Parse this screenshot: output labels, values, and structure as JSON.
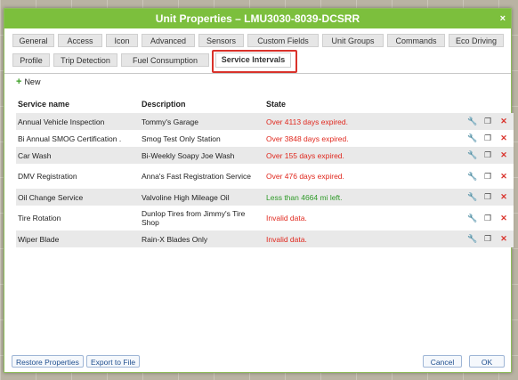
{
  "window": {
    "title": "Unit Properties – LMU3030-8039-DCSRR",
    "close_label": "×"
  },
  "tabs_row1": [
    "General",
    "Access",
    "Icon",
    "Advanced",
    "Sensors",
    "Custom Fields",
    "Unit Groups",
    "Commands",
    "Eco Driving"
  ],
  "tabs_row2": [
    "Profile",
    "Trip Detection",
    "Fuel Consumption",
    "Service Intervals"
  ],
  "active_tab": "Service Intervals",
  "toolbar": {
    "new_label": "New"
  },
  "table": {
    "headers": [
      "Service name",
      "Description",
      "State"
    ],
    "rows": [
      {
        "name": "Annual Vehicle Inspection",
        "description": "Tommy's Garage",
        "state": "Over 4113 days expired.",
        "state_color": "#e0281e"
      },
      {
        "name": "Bi Annual SMOG Certification .",
        "description": "Smog Test Only Station",
        "state": "Over 3848 days expired.",
        "state_color": "#e0281e"
      },
      {
        "name": "Car Wash",
        "description": "Bi-Weekly Soapy Joe Wash",
        "state": "Over 155 days expired.",
        "state_color": "#e0281e"
      },
      {
        "name": "DMV Registration",
        "description": "Anna's Fast Registration Service",
        "state": "Over 476 days expired.",
        "state_color": "#e0281e"
      },
      {
        "name": "Oil Change Service",
        "description": "Valvoline High Mileage Oil",
        "state": "Less than 4664 mi left.",
        "state_color": "#2e9a28"
      },
      {
        "name": "Tire Rotation",
        "description": "Dunlop Tires from Jimmy's Tire Shop",
        "state": "Invalid data.",
        "state_color": "#e0281e"
      },
      {
        "name": "Wiper Blade",
        "description": "Rain-X Blades Only",
        "state": "Invalid data.",
        "state_color": "#e0281e"
      }
    ]
  },
  "footer": {
    "restore_label": "Restore Properties",
    "export_label": "Export to File",
    "cancel_label": "Cancel",
    "ok_label": "OK"
  },
  "icons": {
    "edit": "wrench-icon",
    "copy": "copy-icon",
    "delete": "delete-icon",
    "new": "plus-icon"
  },
  "colors": {
    "title_bar": "#7cbf3d",
    "highlight": "#d9322b"
  }
}
